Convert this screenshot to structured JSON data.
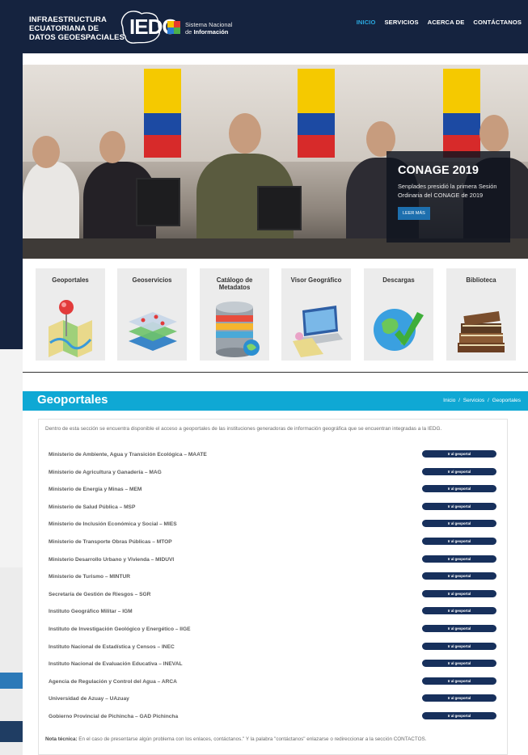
{
  "header": {
    "logo_lines": [
      "INFRAESTRUCTURA",
      "ECUATORIANA DE",
      "DATOS GEOESPACIALES"
    ],
    "logo_acronym": "IEDG",
    "snl_line1": "Sistema Nacional",
    "snl_line2_prefix": "de ",
    "snl_line2_bold": "Información",
    "nav": [
      {
        "label": "INICIO",
        "active": true
      },
      {
        "label": "SERVICIOS",
        "active": false
      },
      {
        "label": "ACERCA DE",
        "active": false
      },
      {
        "label": "CONTÁCTANOS",
        "active": false
      }
    ]
  },
  "hero": {
    "title": "CONAGE 2019",
    "text": "Senplades presidió la primera Sesión Ordinaria del CONAGE de 2019",
    "button_label": "LEER MÁS"
  },
  "tiles": [
    {
      "label": "Geoportales",
      "icon": "map-pin-icon"
    },
    {
      "label": "Geoservicios",
      "icon": "layers-icon"
    },
    {
      "label": "Catálogo de\nMetadatos",
      "icon": "database-icon"
    },
    {
      "label": "Visor Geográfico",
      "icon": "laptop-map-icon"
    },
    {
      "label": "Descargas",
      "icon": "globe-download-icon"
    },
    {
      "label": "Biblioteca",
      "icon": "books-icon"
    }
  ],
  "page": {
    "title": "Geoportales",
    "breadcrumb": [
      "Inicio",
      "/",
      "Servicios",
      "/",
      "Geoportales"
    ],
    "intro": "Dentro de esta sección se encuentra disponible el acceso a geoportales de las instituciones generadoras de información geográfica que se encuentran integradas a la IEDG.",
    "button_label": "Ir al geoportal",
    "institutions": [
      "Ministerio de Ambiente, Agua y Transición Ecológica – MAATE",
      "Ministerio de Agricultura y Ganadería – MAG",
      "Ministerio de Energía y Minas – MEM",
      "Ministerio de Salud Pública – MSP",
      "Ministerio de Inclusión Económica y Social – MIES",
      "Ministerio de Transporte Obras Públicas – MTOP",
      "Ministerio Desarrollo Urbano y Vivienda – MIDUVI",
      "Ministerio de Turismo – MINTUR",
      "Secretaría de Gestión de Riesgos – SGR",
      "Instituto Geográfico Militar – IGM",
      "Instituto de Investigación Geológico y Energético – IIGE",
      "Instituto Nacional de Estadística y Censos – INEC",
      "Instituto Nacional de Evaluación Educativa – INEVAL",
      "Agencia de Regulación y Control del Agua – ARCA",
      "Universidad de Azuay – UAzuay",
      "Gobierno Provincial de Pichincha – GAD Pichincha"
    ],
    "note_label": "Nota técnica:",
    "note_text": " En el caso de presentarse algún problema con los enlaces, contáctanos.\" Y la palabra \"contáctanos\" enlazarse o redireccionar a la sección CONTACTOS."
  },
  "colors": {
    "header_bg": "#15233f",
    "accent": "#0fa8d4",
    "button": "#17305c",
    "nav_active": "#2aa9e0"
  }
}
